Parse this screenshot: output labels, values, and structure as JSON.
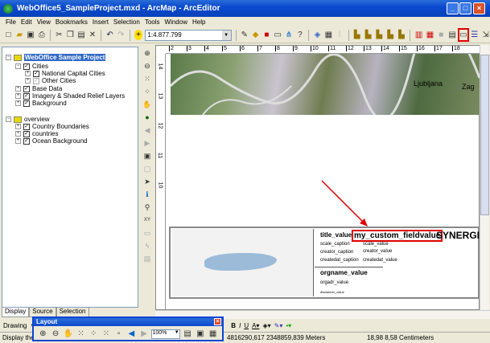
{
  "window": {
    "title": "WebOffice5_SampleProject.mxd - ArcMap - ArcEditor"
  },
  "menu": [
    "File",
    "Edit",
    "View",
    "Bookmarks",
    "Insert",
    "Selection",
    "Tools",
    "Window",
    "Help"
  ],
  "toolbar": {
    "scale": "1:4.877.799"
  },
  "toc": {
    "root": "WebOffice Sample Project",
    "items": [
      "Cities",
      "National Capital Cities",
      "Other Cities",
      "Base Data",
      "Imagery & Shaded Relief Layers",
      "Background"
    ],
    "overview": "overview",
    "overview_items": [
      "Country Boundaries",
      "countries",
      "Ocean Background"
    ],
    "tabs": [
      "Display",
      "Source",
      "Selection"
    ]
  },
  "ruler": {
    "h": [
      "2",
      "3",
      "4",
      "5",
      "6",
      "7",
      "8",
      "9",
      "10",
      "11",
      "12",
      "13",
      "14",
      "15",
      "16",
      "17",
      "18"
    ],
    "v": [
      "14",
      "13",
      "12",
      "11",
      "10"
    ]
  },
  "map": {
    "label": "Ljubljana",
    "label2": "Zag"
  },
  "layout_text": {
    "title": "title_value",
    "custom": "my_custom_fieldvalue",
    "logo": "SYNERGIS",
    "scale_caption": "scale_caption",
    "scale_value": "scale_value",
    "creator_caption": "creator_caption",
    "creator_value": "creator_value",
    "createdat_caption": "createdat_caption",
    "createdat_value": "createdat_value",
    "orgname": "orgname_value",
    "orgadr": "orgadr_value",
    "disclaimer": "disclaimer_value"
  },
  "drawing": {
    "label": "Drawing"
  },
  "layout_toolbar": {
    "title": "Layout",
    "zoom": "100%"
  },
  "status": {
    "message": "Display the pro",
    "coords": "4816290,617  2348859,839 Meters",
    "page": "18,98  8,58 Centimeters"
  },
  "colors": {
    "highlight": "#e00000",
    "selection": "#316ac5"
  }
}
